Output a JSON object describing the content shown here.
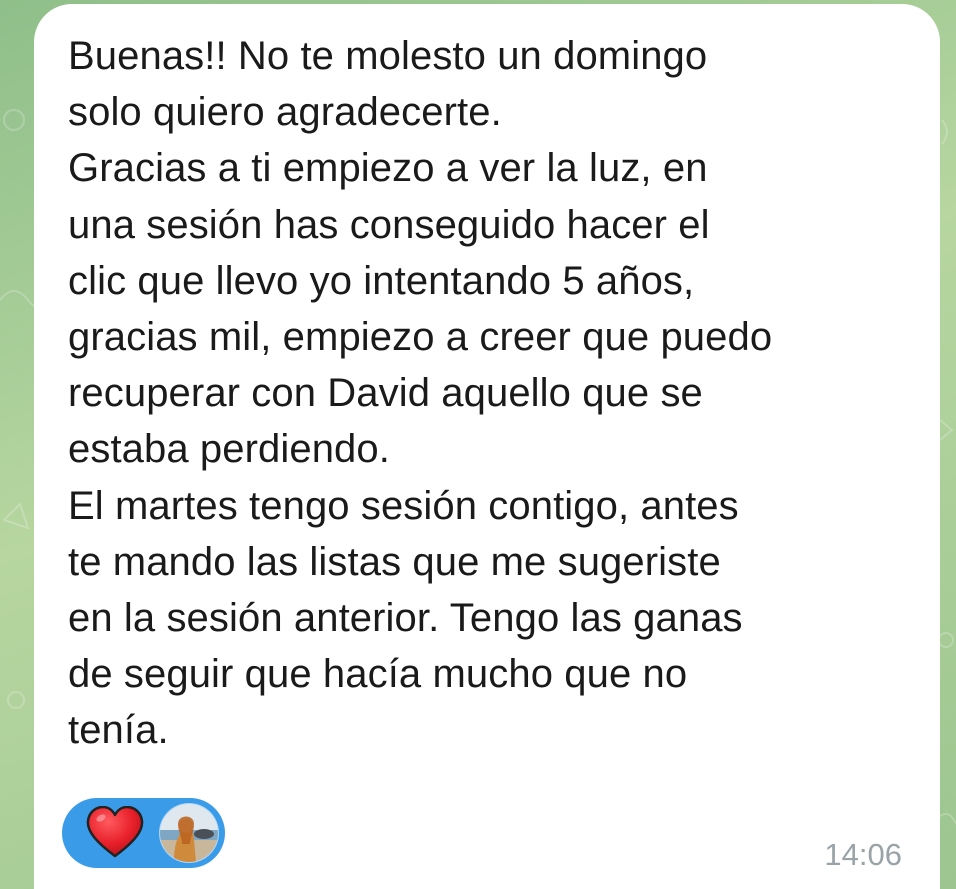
{
  "message": {
    "lines": [
      "Buenas!! No te molesto un domingo",
      "solo quiero agradecerte.",
      "Gracias a ti empiezo a ver la luz, en",
      "una sesión has conseguido hacer el",
      "clic que llevo yo intentando 5 años,",
      "gracias mil, empiezo a creer que puedo",
      "recuperar con David aquello que se",
      "estaba perdiendo.",
      "El martes tengo sesión contigo, antes",
      "te mando las listas que me sugeriste",
      "en la sesión anterior. Tengo las ganas",
      "de seguir que hacía mucho que no",
      "tenía."
    ],
    "time": "14:06"
  },
  "reaction": {
    "emoji": "heart-icon",
    "chip_color": "#3a9be8",
    "heart_color": "#e8202a"
  },
  "colors": {
    "bubble": "#ffffff",
    "text": "#1a1a1a",
    "timestamp": "#9aa3a8",
    "wallpaper": "#a9cf95"
  }
}
